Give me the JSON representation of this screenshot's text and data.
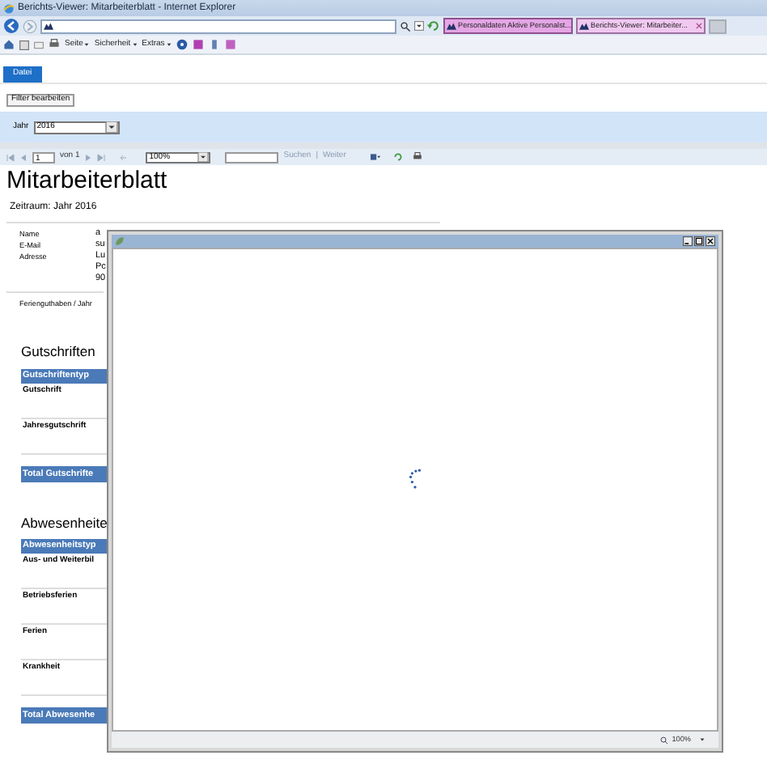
{
  "window": {
    "title": "Berichts-Viewer: Mitarbeiterblatt - Internet Explorer"
  },
  "browser_tabs": [
    {
      "label": "Personaldaten Aktive Personalst...",
      "selected": false
    },
    {
      "label": "Berichts-Viewer: Mitarbeiter...",
      "selected": true
    }
  ],
  "command_bar": {
    "menus": [
      "Seite",
      "Sicherheit",
      "Extras"
    ]
  },
  "ribbon": {
    "tabs": [
      {
        "label": "Datei",
        "selected": true
      }
    ]
  },
  "filter_button": "Filter bearbeiten",
  "parameters": {
    "label": "Jahr",
    "value": "2016"
  },
  "report_toolbar": {
    "page": "1",
    "page_count": "von 1",
    "zoom": "100%",
    "find_link": "Suchen",
    "separator": "|",
    "next_link": "Weiter"
  },
  "report": {
    "title": "Mitarbeiterblatt",
    "period": "Zeitraum: Jahr 2016",
    "info": [
      {
        "label": "Name",
        "lines": [
          "a"
        ]
      },
      {
        "label": "E-Mail",
        "lines": [
          "su"
        ]
      },
      {
        "label": "Adresse",
        "lines": [
          "Lu",
          "Pc",
          "90"
        ]
      }
    ],
    "vacation_label": "Ferienguthaben / Jahr",
    "sections": [
      {
        "heading": "Gutschriften",
        "header": "Gutschriftentyp",
        "rows": [
          "Gutschrift",
          "Jahresgutschrift"
        ],
        "total": "Total Gutschrifte"
      },
      {
        "heading": "Abwesenheite",
        "header": "Abwesenheitstyp",
        "rows": [
          "Aus- und Weiterbil",
          "Betriebsferien",
          "Ferien",
          "Krankheit"
        ],
        "total": "Total Abwesenhe"
      }
    ]
  },
  "popup": {
    "zoom": "100%"
  }
}
